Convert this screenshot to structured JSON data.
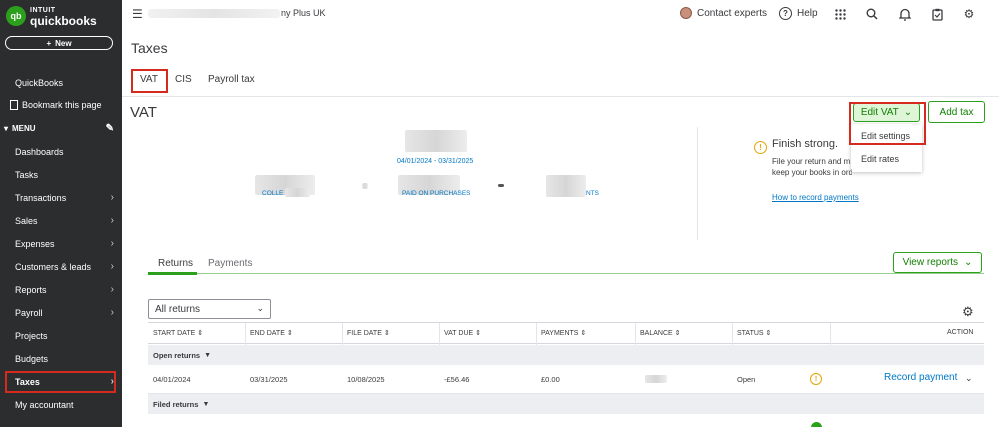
{
  "brand": {
    "logo_letters": "qb",
    "line1": "INTUIT",
    "line2": "quickbooks",
    "color": "#2ca01c"
  },
  "sidebar": {
    "new_label": "New",
    "items_top": [
      {
        "label": "QuickBooks"
      },
      {
        "label": "Bookmark this page"
      }
    ],
    "menu_label": "MENU",
    "items": [
      {
        "label": "Dashboards",
        "chevron": false
      },
      {
        "label": "Tasks",
        "chevron": false
      },
      {
        "label": "Transactions",
        "chevron": true
      },
      {
        "label": "Sales",
        "chevron": true
      },
      {
        "label": "Expenses",
        "chevron": true
      },
      {
        "label": "Customers & leads",
        "chevron": true
      },
      {
        "label": "Reports",
        "chevron": true
      },
      {
        "label": "Payroll",
        "chevron": true
      },
      {
        "label": "Projects",
        "chevron": false
      },
      {
        "label": "Budgets",
        "chevron": false
      },
      {
        "label": "Taxes",
        "chevron": true,
        "active": true
      },
      {
        "label": "My accountant",
        "chevron": false
      }
    ]
  },
  "topbar": {
    "company_suffix": "ny Plus UK",
    "contact_label": "Contact experts",
    "help_label": "Help"
  },
  "page": {
    "title": "Taxes",
    "tabs": [
      "VAT",
      "CIS",
      "Payroll tax"
    ],
    "active_tab": "VAT"
  },
  "vat": {
    "heading": "VAT",
    "edit_vat_label": "Edit VAT",
    "add_tax_label": "Add tax",
    "dropdown": [
      "Edit settings",
      "Edit rates"
    ],
    "period": "04/01/2024 - 03/31/2025",
    "summary_labels": {
      "collected": "COLLE",
      "purchases": "PAID ON PURCHASES",
      "net": "NTS"
    },
    "finish": {
      "title": "Finish strong.",
      "body_line1": "File your return and m",
      "body_line2": "keep your books in order.",
      "link": "How to record payments"
    }
  },
  "returns": {
    "subtabs": [
      "Returns",
      "Payments"
    ],
    "active_subtab": "Returns",
    "view_reports_label": "View reports",
    "filter_value": "All returns",
    "columns": [
      "START DATE",
      "END DATE",
      "FILE DATE",
      "VAT DUE",
      "PAYMENTS",
      "BALANCE",
      "STATUS",
      "ACTION"
    ],
    "open_group": "Open returns",
    "filed_group": "Filed returns",
    "open_rows": [
      {
        "start_date": "04/01/2024",
        "end_date": "03/31/2025",
        "file_date": "10/08/2025",
        "vat_due": "-£56.46",
        "payments": "£0.00",
        "status": "Open",
        "action": "Record payment"
      }
    ]
  },
  "colors": {
    "accent_green": "#2ca01c",
    "link_blue": "#0077c5",
    "sidebar_bg": "#2b2d2f",
    "highlight_red": "#d52b1e",
    "warning": "#e5a500"
  }
}
